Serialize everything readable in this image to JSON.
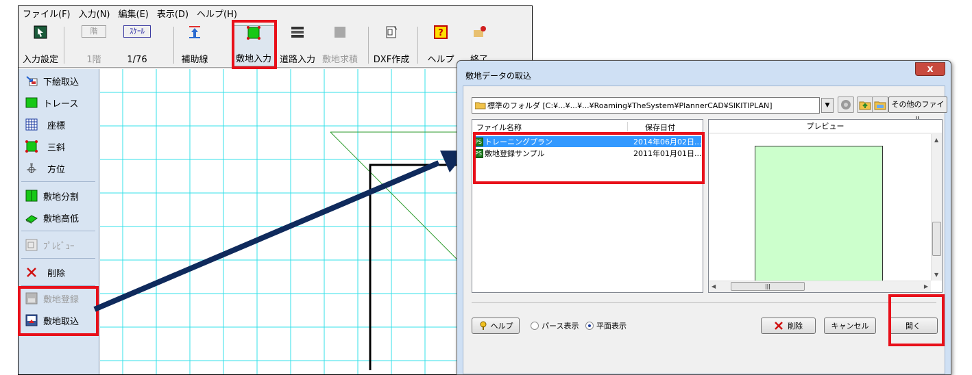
{
  "menubar": {
    "items": [
      "ファイル(F)",
      "入力(N)",
      "編集(E)",
      "表示(D)",
      "ヘルプ(H)"
    ]
  },
  "toolbar": {
    "input_settings": "入力設定",
    "floor_top": "階",
    "floor_label": "1階",
    "scale_top": "ｽｹｰﾙ",
    "scale_label": "1/76",
    "guide_line": "補助線",
    "site_input": "敷地入力",
    "road_input": "道路入力",
    "site_area": "敷地求積",
    "dxf_create": "DXF作成",
    "help": "ヘルプ",
    "exit": "終了"
  },
  "sidebar": {
    "items": [
      {
        "label": "下絵取込",
        "icon": "import-underlay-icon",
        "enabled": true
      },
      {
        "label": "トレース",
        "icon": "trace-icon",
        "enabled": true
      },
      {
        "label": "座標",
        "icon": "grid-coordinates-icon",
        "enabled": true
      },
      {
        "label": "三斜",
        "icon": "triangle-measure-icon",
        "enabled": true
      },
      {
        "label": "方位",
        "icon": "compass-icon",
        "enabled": true
      },
      {
        "label": "敷地分割",
        "icon": "site-split-icon",
        "enabled": true
      },
      {
        "label": "敷地高低",
        "icon": "site-elevation-icon",
        "enabled": true
      },
      {
        "label": "ﾌﾟﾚﾋﾞｭｰ",
        "icon": "preview-icon",
        "enabled": false
      },
      {
        "label": "削除",
        "icon": "delete-x-icon",
        "enabled": true
      },
      {
        "label": "敷地登録",
        "icon": "site-register-icon",
        "enabled": false
      },
      {
        "label": "敷地取込",
        "icon": "site-import-icon",
        "enabled": true
      }
    ]
  },
  "dialog": {
    "title": "敷地データの取込",
    "close": "x",
    "folder_path": "標準のフォルダ [C:¥...¥...¥...¥Roaming¥TheSystem¥PlannerCAD¥SIKITIPLAN]",
    "other_files": "その他のファイル",
    "columns": {
      "name": "ファイル名称",
      "date": "保存日付"
    },
    "files": [
      {
        "name": "トレーニングプラン",
        "date": "2014年06月02日...",
        "selected": true
      },
      {
        "name": "敷地登録サンプル",
        "date": "2011年01月01日...",
        "selected": false
      }
    ],
    "preview_label": "プレビュー",
    "help_btn": "ヘルプ",
    "radio_perspective": "パース表示",
    "radio_plan": "平面表示",
    "radio_selected": "plan",
    "delete_btn": "削除",
    "cancel_btn": "キャンセル",
    "open_btn": "開く"
  },
  "colors": {
    "highlight": "#e8101a",
    "arrow": "#0f2a5c",
    "grid": "#33e0e8",
    "selection": "#3399ff",
    "preview_fill": "#ccffcc"
  }
}
